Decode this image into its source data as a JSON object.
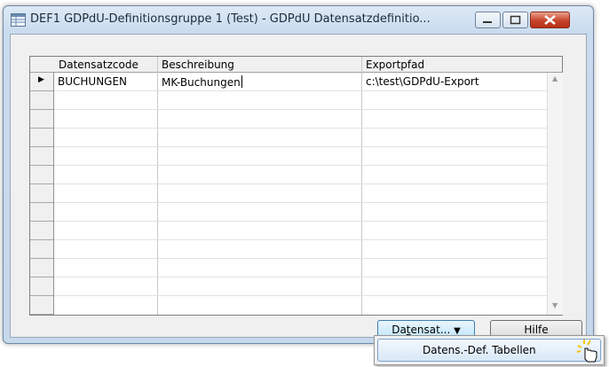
{
  "window": {
    "title": "DEF1 GDPdU-Definitionsgruppe 1 (Test) - GDPdU Datensatzdefinitio..."
  },
  "caption_buttons": {
    "minimize_icon": "minimize-icon",
    "maximize_icon": "maximize-icon",
    "close_icon": "close-icon"
  },
  "grid": {
    "columns": [
      "Datensatzcode",
      "Beschreibung",
      "Exportpfad"
    ],
    "rows": [
      {
        "code": "BUCHUNGEN",
        "beschreibung": "MK-Buchungen",
        "exportpfad": "c:\\test\\GDPdU-Export",
        "current": true
      }
    ],
    "current_row_marker": "▶"
  },
  "buttons": {
    "datensatz_prefix": "Da",
    "datensatz_mnemonic": "t",
    "datensatz_rest": "ensat... ",
    "datensatz_arrow": "▼",
    "hilfe": "Hilfe"
  },
  "menu": {
    "items": [
      "Datens.-Def. Tabellen"
    ]
  },
  "colors": {
    "accent": "#3c7fb1",
    "titlebar": "#c9dbef",
    "close": "#c7432a"
  }
}
